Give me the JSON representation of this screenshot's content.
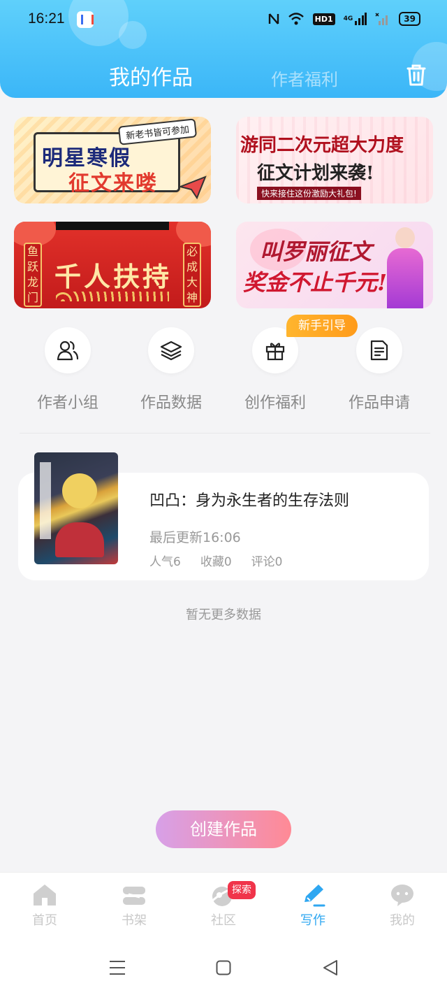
{
  "status_bar": {
    "time": "16:21",
    "network": "4G",
    "hd_label": "HD1",
    "battery": "39"
  },
  "header": {
    "tab_active": "我的作品",
    "tab_inactive": "作者福利"
  },
  "banners": [
    {
      "main": "明星寒假",
      "sub": "征文来喽",
      "tag": "新老书皆可参加"
    },
    {
      "main": "游同二次元超大力度",
      "sub": "征文计划来袭!",
      "tag": "快来接住这份激励大礼包!"
    },
    {
      "main": "千人扶持",
      "left": "鱼跃龙门",
      "right": "必成大神"
    },
    {
      "main": "叫罗丽征文",
      "sub": "奖金不止千元!"
    }
  ],
  "quick_actions": [
    {
      "label": "作者小组",
      "icon": "people-icon"
    },
    {
      "label": "作品数据",
      "icon": "layers-icon"
    },
    {
      "label": "创作福利",
      "icon": "gift-icon"
    },
    {
      "label": "作品申请",
      "icon": "document-icon"
    }
  ],
  "guide_badge": "新手引导",
  "work": {
    "title": "凹凸：身为永生者的生存法则",
    "updated": "最后更新16:06",
    "popularity": "人气6",
    "favorites": "收藏0",
    "comments": "评论0"
  },
  "no_more": "暂无更多数据",
  "create_button": "创建作品",
  "bottom_nav": [
    {
      "label": "首页",
      "icon": "home-icon"
    },
    {
      "label": "书架",
      "icon": "bookshelf-icon"
    },
    {
      "label": "社区",
      "icon": "community-icon"
    },
    {
      "label": "写作",
      "icon": "write-icon"
    },
    {
      "label": "我的",
      "icon": "profile-icon"
    }
  ],
  "explore_badge": "探索",
  "colors": {
    "header": "#3bb6f8",
    "active_nav": "#2fa7f1",
    "guide_badge": "#ffa726",
    "explore_badge": "#f0344a"
  }
}
